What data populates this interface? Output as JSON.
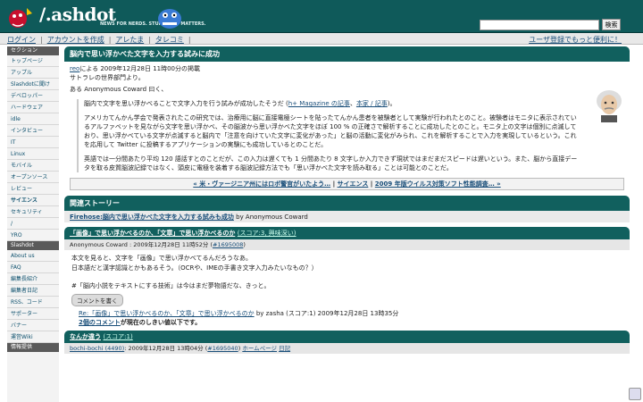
{
  "header": {
    "logo_text": "/.ashdot",
    "tagline": "NEWS FOR NERDS. STUFF THAT MATTERS.",
    "search_button": "検索"
  },
  "topnav": {
    "login": "ログイン",
    "create_account": "アカウントを作成",
    "tare": "アレたま",
    "tarekomi": "タレコミ",
    "right_text": "ユーザ登録でもっと便利に！"
  },
  "sidebar": {
    "sections_title": "セクション",
    "sections": [
      "トップページ",
      "アップル",
      "Slashdotに聞け",
      "デベロッパー",
      "ハードウェア",
      "idle",
      "インタビュー",
      "IT",
      "Linux",
      "モバイル",
      "オープンソース",
      "レビュー",
      "サイエンス",
      "セキュリティ",
      "/",
      "YRO"
    ],
    "slashdot_title": "Slashdot",
    "slashdot_items": [
      "About us",
      "FAQ",
      "編集長紹介",
      "編集者日記",
      "RSS、コード",
      "サポーター",
      "バナー",
      "運営Wiki"
    ],
    "info_title": "情報提供"
  },
  "article": {
    "title": "脳内で思い浮かべた文字を入力する試みに成功",
    "poster": "reo",
    "posted_text": "による 2009年12月28日 11時00分の掲載",
    "dept": "サトラレの世界部門より。",
    "intro": "ある Anonymous Coward 曰く、",
    "p1_prefix": "脳内で文字を思い浮かべることで文字入力を行う試みが成功したそうだ (",
    "p1_link1": "h+ Magazine の記事",
    "p1_sep": "、",
    "p1_link2": "本家 / 記事",
    "p1_suffix": ")。",
    "p2": "アメリカてんかん学会で発表されたこの研究では、治療用に脳に直接電極シートを貼ったてんかん患者を被験者として実験が行われたとのこと。被験者はモニタに表示されているアルファベットを見ながら文字を思い浮かべ、その脳波から思い浮かべた文字をほぼ 100 % の正確さで解析することに成功したとのこと。モニタ上の文字は個別に点滅しており、思い浮かべている文字が点滅すると脳内で「注意を向けていた文字に変化があった」と脳の活動に変化がみられ、これを解析することで入力を実現しているという。これを応用して Twitter に投稿するアプリケーションの実験にも成功しているとのことだ。",
    "p3": "英語では一分間あたり平均 120 語話すとのことだが、この入力は遅くても 1 分間あたり 8 文字しか入力できず現状ではまだまだスピードは遅いという。また、脳から直接データを取る皮質脳波記録ではなく、頭皮に電極を装着する脳波記録方法でも「思い浮かべた文字を読み取る」ことは可能とのことだ。"
  },
  "article_nav": {
    "prev": "« 米・ヴァージニア州にはロボ警官がいたよう…",
    "section": "サイエンス",
    "next": "2009 年版ウイルス対策ソフト性能調査… »"
  },
  "related": {
    "title": "関連ストーリー",
    "story_link": "Firehose:脳内で思い浮かべた文字を入力する試みも成功",
    "story_by": "by Anonymous Coward"
  },
  "comment1": {
    "title": "「画像」で思い浮かべるのか、「文章」で思い浮かべるのか",
    "score": "(スコア:3, 興味深い)",
    "meta_prefix": "Anonymous Coward : 2009年12月28日 11時52分 (",
    "meta_id": "#1695008",
    "meta_suffix": ")",
    "line1": "本文を見ると、文字を「画像」で思い浮かべてるんだろうなあ。",
    "line2": "日本語だと漢字認識とかもあるそう。（OCRや、IMEの手書き文字入力みたいなもの？）",
    "line3": "",
    "line4": "#「脳内小説をテキストにする技術」は今はまだ夢物語だな、きっと。",
    "reply_button": "コメントを書く",
    "reply_link": "Re:「画像」で思い浮かべるのか、「文章」で思い浮かべるのか",
    "reply_meta": "by zasha (スコア:1) 2009年12月28日 13時35分",
    "threshold_link": "2個のコメント",
    "threshold_text": "が現在のしきい値以下です。"
  },
  "comment2": {
    "title": "なんか違う",
    "score": "(スコア:1)",
    "meta_user": "bochi-bochi (4490)",
    "meta_date": ": 2009年12月28日 13時04分 (",
    "meta_id": "#1695040",
    "meta_suffix": ")",
    "homepage": "ホームページ",
    "diary": "日記"
  }
}
